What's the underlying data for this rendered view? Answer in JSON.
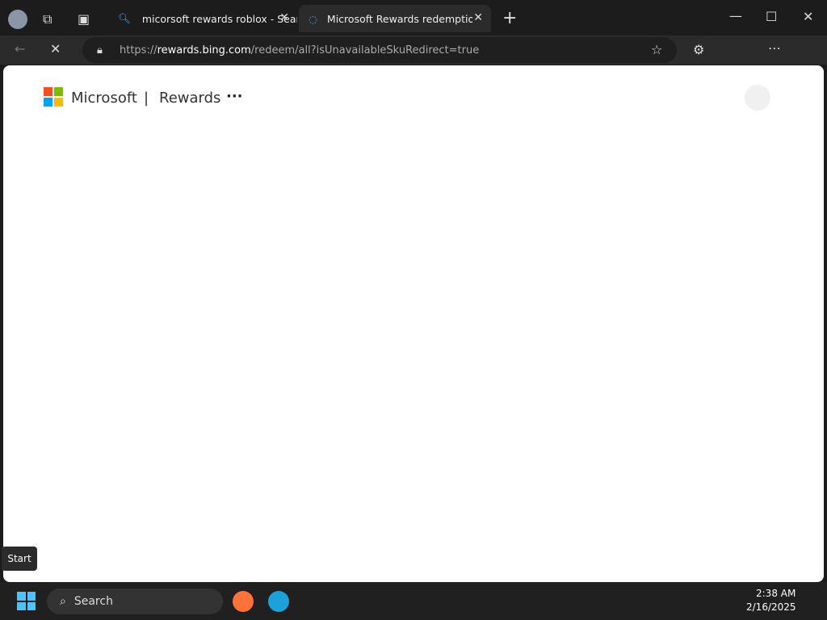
{
  "tabs": [
    {
      "label": "micorsoft rewards roblox - Search"
    },
    {
      "label": "Microsoft Rewards redemption ce"
    }
  ],
  "address": {
    "prefix": "https://",
    "host": "rewards.bing.com",
    "path": "/redeem/all?isUnavailableSkuRedirect=true"
  },
  "header": {
    "brand": "Microsoft",
    "divider": "|",
    "section": "Rewards",
    "more": "···"
  },
  "tooltip": "Start",
  "taskbar": {
    "search": "Search",
    "time": "2:38 AM",
    "date": "2/16/2025"
  }
}
